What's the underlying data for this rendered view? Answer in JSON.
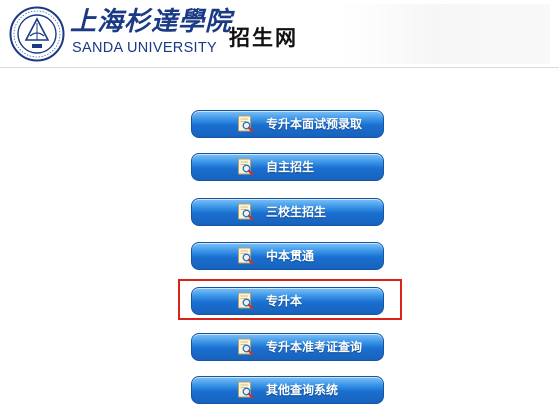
{
  "header": {
    "school_cn": "上海杉達學院",
    "school_en": "SANDA UNIVERSITY",
    "site_title": "招生网"
  },
  "menu": {
    "items": [
      {
        "label": "专升本面试预录取"
      },
      {
        "label": "自主招生"
      },
      {
        "label": "三校生招生"
      },
      {
        "label": "中本贯通"
      },
      {
        "label": "专升本"
      },
      {
        "label": "专升本准考证查询"
      },
      {
        "label": "其他查询系统"
      }
    ],
    "highlighted_index": 4,
    "highlight_color": "#d8231a",
    "button_color": "#1a6fd0"
  },
  "icons": {
    "button_icon": "magnifier-document-icon",
    "seal": "university-seal-icon"
  }
}
